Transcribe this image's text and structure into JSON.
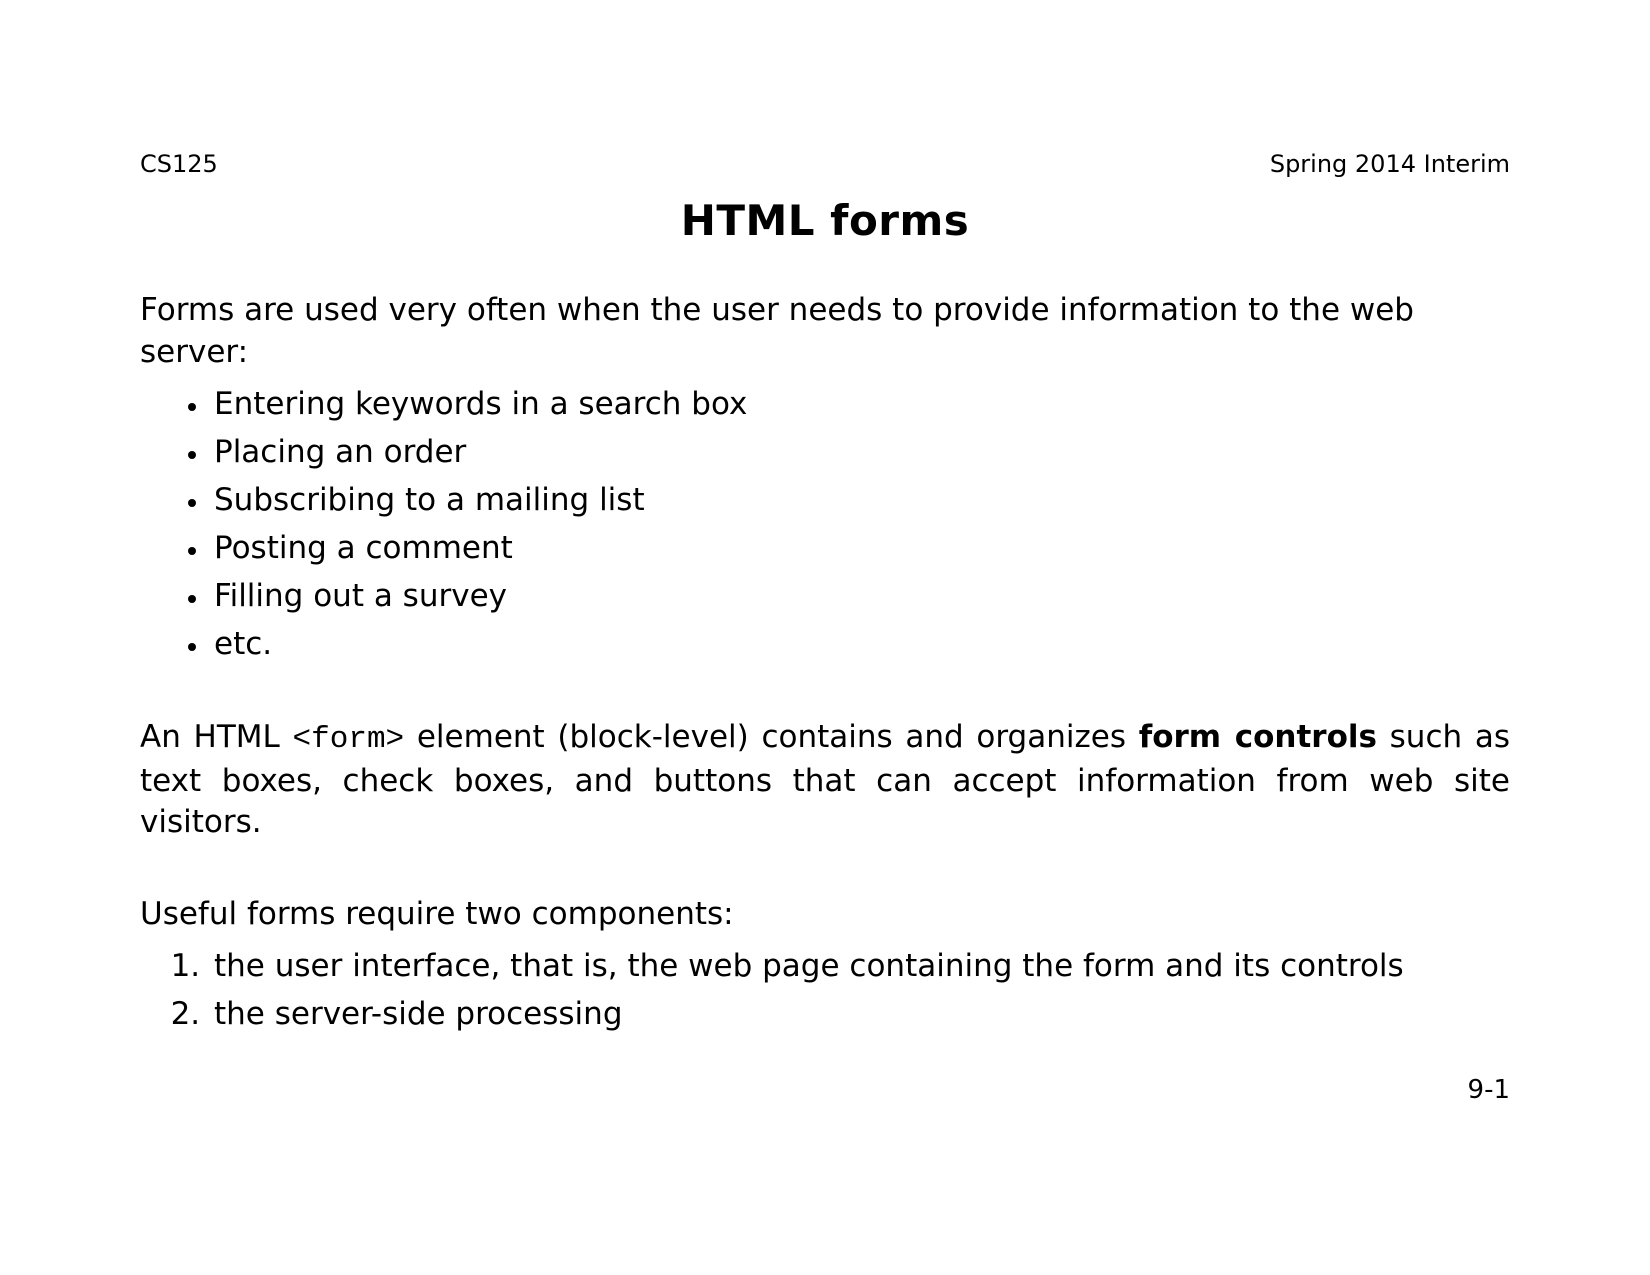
{
  "header": {
    "left": "CS125",
    "right": "Spring 2014 Interim"
  },
  "title": "HTML forms",
  "intro": "Forms are used very often when the user needs to provide information to the web server:",
  "bullets": [
    "Entering keywords in a search box",
    "Placing an order",
    "Subscribing to a mailing list",
    "Posting a comment",
    "Filling out a survey",
    "etc."
  ],
  "para_form": {
    "t1": "An HTML ",
    "code": "<form>",
    "t2": " element (block-level) contains and organizes ",
    "bold": "form controls",
    "t3": " such as text boxes, check boxes, and buttons that can accept information from web site visitors."
  },
  "components_intro": "Useful forms require two components:",
  "components": [
    "the user interface, that is, the web page containing the form and its controls",
    "the server-side processing"
  ],
  "page_number": "9-1"
}
